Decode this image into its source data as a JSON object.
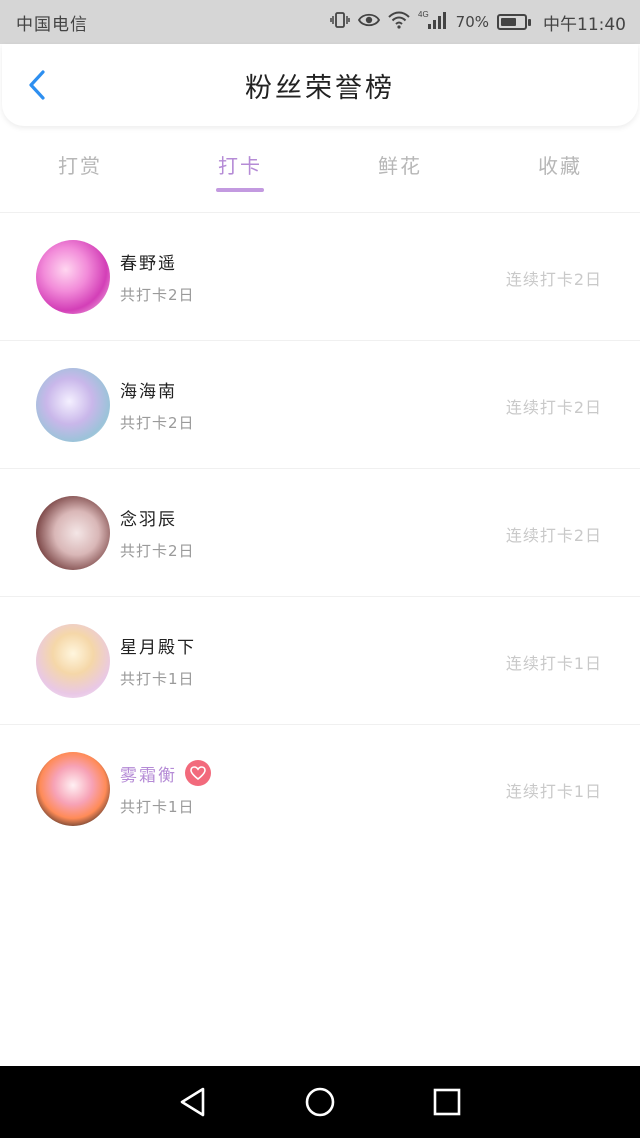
{
  "status_bar": {
    "carrier": "中国电信",
    "network": "4G",
    "battery_percent": "70%",
    "time": "中午11:40"
  },
  "header": {
    "title": "粉丝荣誉榜",
    "back_icon": "chevron-left-icon"
  },
  "tabs": [
    {
      "label": "打赏",
      "active": false
    },
    {
      "label": "打卡",
      "active": true
    },
    {
      "label": "鲜花",
      "active": false
    },
    {
      "label": "收藏",
      "active": false
    }
  ],
  "fans": [
    {
      "name": "春野遥",
      "total": "共打卡2日",
      "streak": "连续打卡2日",
      "vip": false
    },
    {
      "name": "海海南",
      "total": "共打卡2日",
      "streak": "连续打卡2日",
      "vip": false
    },
    {
      "name": "念羽辰",
      "total": "共打卡2日",
      "streak": "连续打卡2日",
      "vip": false
    },
    {
      "name": "星月殿下",
      "total": "共打卡1日",
      "streak": "连续打卡1日",
      "vip": false
    },
    {
      "name": "雾霜衡",
      "total": "共打卡1日",
      "streak": "连续打卡1日",
      "vip": true
    }
  ],
  "colors": {
    "accent": "#b58bd6",
    "heart_badge": "#f26a7c",
    "back_arrow": "#2d8ff0"
  }
}
